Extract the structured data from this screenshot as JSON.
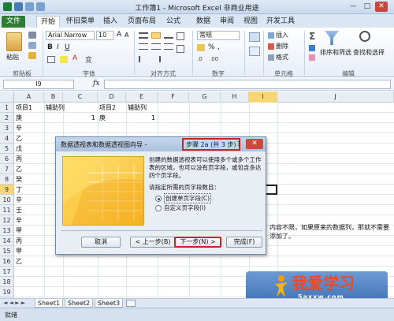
{
  "window": {
    "title": "工作簿1 - Microsoft Excel 非商业用途",
    "controls": [
      "—",
      "□",
      "✕"
    ]
  },
  "ribbon_tabs": [
    "文件",
    "开始",
    "怀旧菜单",
    "插入",
    "页面布局",
    "公式",
    "数据",
    "审阅",
    "视图",
    "开发工具"
  ],
  "ribbon": {
    "paste_label": "粘贴",
    "font_name": "Arial Narrow",
    "font_size": "10",
    "number_format": "常规",
    "insert_label": "插入",
    "delete_label": "删除",
    "format_label": "格式",
    "sort_filter_label": "排序和筛选",
    "find_select_label": "查找和选择",
    "groups": [
      "剪贴板",
      "字体",
      "对齐方式",
      "数字",
      "单元格",
      "编辑"
    ]
  },
  "formula_bar": {
    "name_box": "I9",
    "fx": "fx",
    "value": ""
  },
  "grid": {
    "columns": [
      "A",
      "B",
      "C",
      "D",
      "E",
      "F",
      "G",
      "H",
      "I",
      "J"
    ],
    "rows": [
      {
        "n": "1",
        "A": "项目1",
        "B": "辅助列",
        "D": "项目2",
        "E": "辅助列"
      },
      {
        "n": "2",
        "A": "庚",
        "C": "1",
        "D": "庚",
        "E": "1"
      },
      {
        "n": "3",
        "A": "辛"
      },
      {
        "n": "4",
        "A": "乙"
      },
      {
        "n": "5",
        "A": "戊"
      },
      {
        "n": "6",
        "A": "丙"
      },
      {
        "n": "7",
        "A": "乙"
      },
      {
        "n": "8",
        "A": "癸"
      },
      {
        "n": "9",
        "A": "丁"
      },
      {
        "n": "10",
        "A": "辛"
      },
      {
        "n": "11",
        "A": "壬"
      },
      {
        "n": "12",
        "A": "辛"
      },
      {
        "n": "13",
        "A": "甲"
      },
      {
        "n": "14",
        "A": "丙"
      },
      {
        "n": "15",
        "A": "甲"
      },
      {
        "n": "16",
        "A": "乙"
      },
      {
        "n": "17",
        "A": ""
      },
      {
        "n": "18",
        "A": ""
      },
      {
        "n": "19",
        "A": ""
      },
      {
        "n": "20",
        "A": ""
      }
    ]
  },
  "background_text": "内容不限，如果原来的数据列，那就不需要添加了。",
  "sheet_tabs": [
    "Sheet1",
    "Sheet2",
    "Sheet3"
  ],
  "status": {
    "mode": "就绪"
  },
  "dialog": {
    "title": "数据透视表和数据透视图向导 -",
    "step": "步骤 2a (共 3 步)",
    "help": "?",
    "close": "✕",
    "description": "创建的数据透视表可以使用多个或多个工作表的区域，也可以没有页字段，或包含多达四个页字段。",
    "question": "请指定所需的页字段数目：",
    "options": [
      {
        "label": "创建单页字段(C)",
        "selected": true
      },
      {
        "label": "自定义页字段(I)",
        "selected": false
      }
    ],
    "buttons": {
      "cancel": "取消",
      "back": "< 上一步(B)",
      "next": "下一步(N) >",
      "finish": "完成(F)"
    }
  },
  "watermark": {
    "text": "我爱学习",
    "url": "5axxw.com"
  }
}
